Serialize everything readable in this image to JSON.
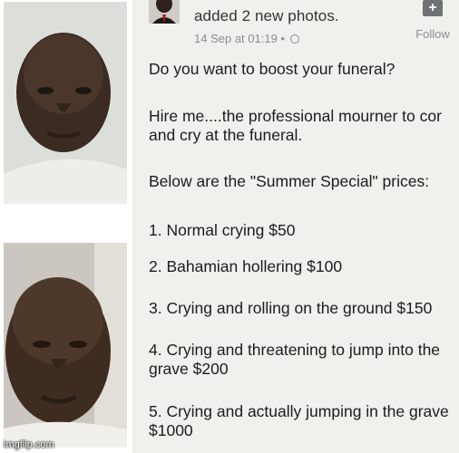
{
  "header": {
    "action_text": "added 2 new photos.",
    "timestamp": "14 Sep at 01:19 •",
    "follow_label": "Follow",
    "follow_icon": "+"
  },
  "post": {
    "question": "Do you want to boost your funeral?",
    "hire_line1": "Hire me....the professional mourner to cor",
    "hire_line2": "and cry at the funeral.",
    "below": "Below are the \"Summer Special\"  prices:",
    "items": [
      {
        "line1": "1. Normal crying $50",
        "line2": ""
      },
      {
        "line1": "2. Bahamian hollering $100",
        "line2": ""
      },
      {
        "line1": "3. Crying and rolling on the ground $150",
        "line2": ""
      },
      {
        "line1": "4. Crying and threatening to jump into the",
        "line2": "grave $200"
      },
      {
        "line1": "5. Crying and actually jumping in the grave",
        "line2": "$1000"
      }
    ]
  },
  "watermark": "imgflip.com"
}
